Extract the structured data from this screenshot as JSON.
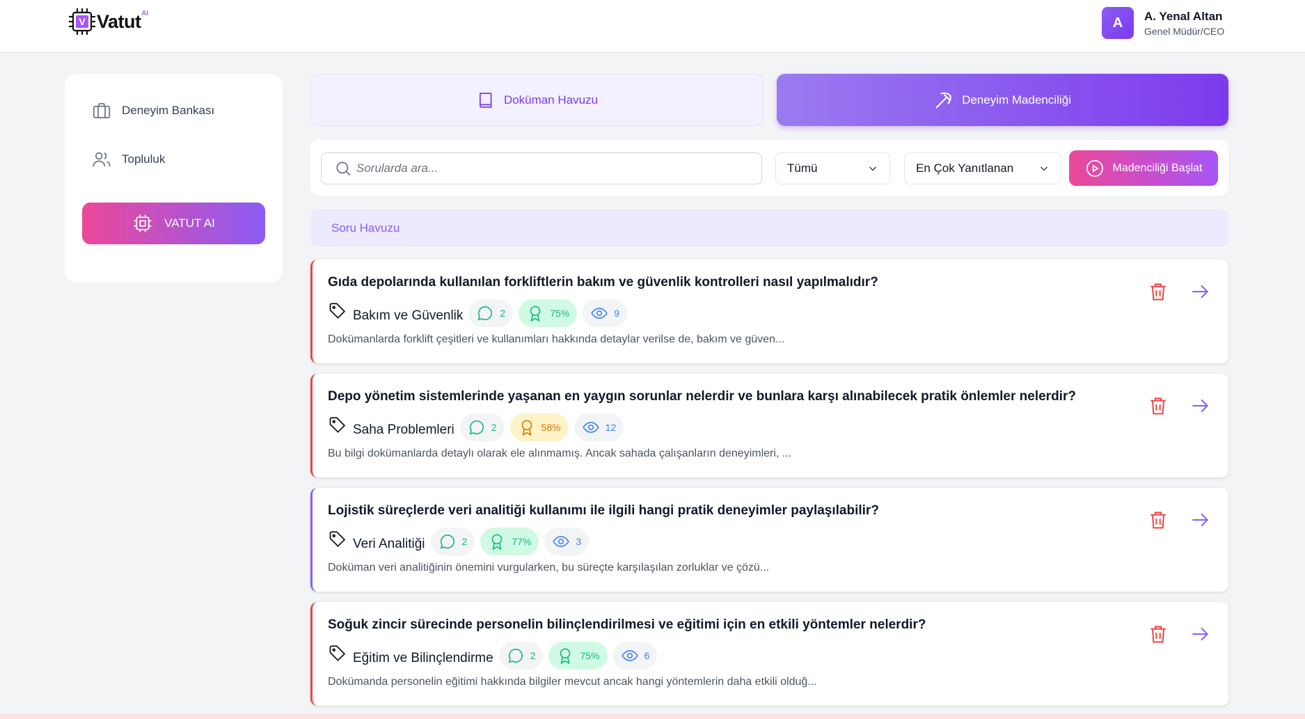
{
  "brand": {
    "name": "Vatut",
    "sup": "AI",
    "chip_letter": "V"
  },
  "user": {
    "initial": "A",
    "name": "A. Yenal Altan",
    "role": "Genel Müdür/CEO"
  },
  "sidebar": {
    "items": [
      {
        "label": "Deneyim Bankası",
        "icon": "briefcase-icon"
      },
      {
        "label": "Topluluk",
        "icon": "users-icon"
      }
    ],
    "ai_button": "VATUT AI"
  },
  "tabs": [
    {
      "label": "Doküman Havuzu",
      "icon": "book-icon",
      "active": false
    },
    {
      "label": "Deneyim Madenciliği",
      "icon": "pickaxe-icon",
      "active": true
    }
  ],
  "search": {
    "placeholder": "Sorularda ara...",
    "filter_selected": "Tümü",
    "sort_selected": "En Çok Yanıtlanan",
    "start_button": "Madenciliği Başlat"
  },
  "pool_header": "Soru Havuzu",
  "questions": [
    {
      "title": "Gıda depolarında kullanılan forkliftlerin bakım ve güvenlik kontrolleri nasıl yapılmalıdır?",
      "category": "Bakım ve Güvenlik",
      "comments": "2",
      "score": "75%",
      "views": "9",
      "desc": "Dokümanlarda forklift çeşitleri ve kullanımları hakkında detaylar verilse de, bakım ve güven..."
    },
    {
      "title": "Depo yönetim sistemlerinde yaşanan en yaygın sorunlar nelerdir ve bunlara karşı alınabilecek pratik önlemler nelerdir?",
      "category": "Saha Problemleri",
      "comments": "2",
      "score": "58%",
      "views": "12",
      "desc": "Bu bilgi dokümanlarda detaylı olarak ele alınmamış. Ancak sahada çalışanların deneyimleri, ..."
    },
    {
      "title": "Lojistik süreçlerde veri analitiği kullanımı ile ilgili hangi pratik deneyimler paylaşılabilir?",
      "category": "Veri Analitiği",
      "comments": "2",
      "score": "77%",
      "views": "3",
      "desc": "Doküman veri analitiğinin önemini vurgularken, bu süreçte karşılaşılan zorluklar ve çözü..."
    },
    {
      "title": "Soğuk zincir sürecinde personelin bilinçlendirilmesi ve eğitimi için en etkili yöntemler nelerdir?",
      "category": "Eğitim ve Bilinçlendirme",
      "comments": "2",
      "score": "75%",
      "views": "6",
      "desc": "Dokümanda personelin eğitimi hakkında bilgiler mevcut ancak hangi yöntemlerin daha etkili olduğ..."
    }
  ],
  "colors": {
    "accent": "#7c3aed",
    "pink": "#ec4899",
    "danger": "#ef4444",
    "success": "#10b981",
    "warning": "#d97706",
    "info": "#3b82f6"
  }
}
